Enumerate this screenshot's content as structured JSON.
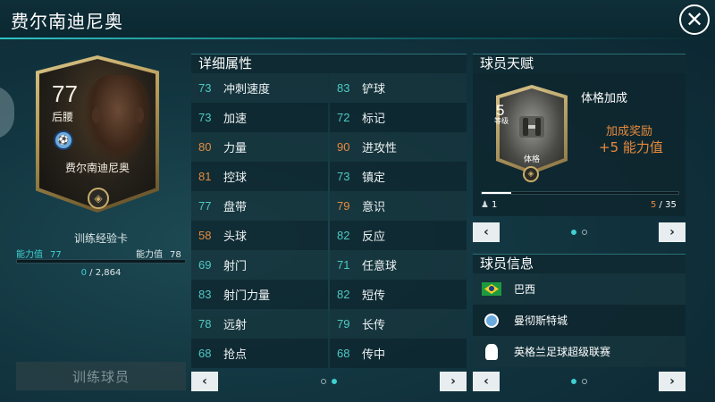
{
  "header": {
    "title": "费尔南迪尼奥",
    "close_symbol": "✕"
  },
  "card": {
    "rating": "77",
    "position": "后腰",
    "name": "费尔南迪尼奥",
    "chem_symbol": "◈",
    "club_symbol": "⚽"
  },
  "training": {
    "label": "训练经验卡",
    "power_left_label": "能力值",
    "power_left_value": "77",
    "power_right_label": "能力值",
    "power_right_value": "78",
    "xp_current": "0",
    "xp_separator": " / ",
    "xp_total": "2,864",
    "xp_fraction": 0,
    "button": "训练球员"
  },
  "attributes": {
    "title": "详细属性",
    "rows": [
      [
        {
          "value": "73",
          "name": "冲刺速度",
          "color": "#4ec9c4"
        },
        {
          "value": "83",
          "name": "铲球",
          "color": "#4ec9c4"
        }
      ],
      [
        {
          "value": "73",
          "name": "加速",
          "color": "#4ec9c4"
        },
        {
          "value": "72",
          "name": "标记",
          "color": "#4ec9c4"
        }
      ],
      [
        {
          "value": "80",
          "name": "力量",
          "color": "#e88a3c"
        },
        {
          "value": "90",
          "name": "进攻性",
          "color": "#e88a3c"
        }
      ],
      [
        {
          "value": "81",
          "name": "控球",
          "color": "#e88a3c"
        },
        {
          "value": "73",
          "name": "镇定",
          "color": "#4ec9c4"
        }
      ],
      [
        {
          "value": "77",
          "name": "盘带",
          "color": "#4ec9c4"
        },
        {
          "value": "79",
          "name": "意识",
          "color": "#e88a3c"
        }
      ],
      [
        {
          "value": "58",
          "name": "头球",
          "color": "#e88a3c"
        },
        {
          "value": "82",
          "name": "反应",
          "color": "#4ec9c4"
        }
      ],
      [
        {
          "value": "69",
          "name": "射门",
          "color": "#4ec9c4"
        },
        {
          "value": "71",
          "name": "任意球",
          "color": "#4ec9c4"
        }
      ],
      [
        {
          "value": "83",
          "name": "射门力量",
          "color": "#4ec9c4"
        },
        {
          "value": "82",
          "name": "短传",
          "color": "#4ec9c4"
        }
      ],
      [
        {
          "value": "78",
          "name": "远射",
          "color": "#4ec9c4"
        },
        {
          "value": "79",
          "name": "长传",
          "color": "#4ec9c4"
        }
      ],
      [
        {
          "value": "68",
          "name": "抢点",
          "color": "#4ec9c4"
        },
        {
          "value": "68",
          "name": "传中",
          "color": "#4ec9c4"
        }
      ]
    ],
    "prev": "‹",
    "next": "›"
  },
  "talent": {
    "title": "球员天赋",
    "level": "5",
    "level_label": "等级",
    "card_label": "体格",
    "name": "体格加成",
    "bonus_label": "加成奖励",
    "bonus_value": "+5 能力值",
    "min_icon": "♟",
    "min": "1",
    "current": "5",
    "separator": " / ",
    "max": "35",
    "progress_fraction": 0.15,
    "prev": "‹",
    "next": "›"
  },
  "info": {
    "title": "球员信息",
    "items": [
      {
        "icon": "brazil-flag-icon",
        "text": "巴西"
      },
      {
        "icon": "manchester-city-badge-icon",
        "text": "曼彻斯特城"
      },
      {
        "icon": "premier-league-logo-icon",
        "text": "英格兰足球超级联赛"
      }
    ],
    "prev": "‹",
    "next": "›"
  }
}
